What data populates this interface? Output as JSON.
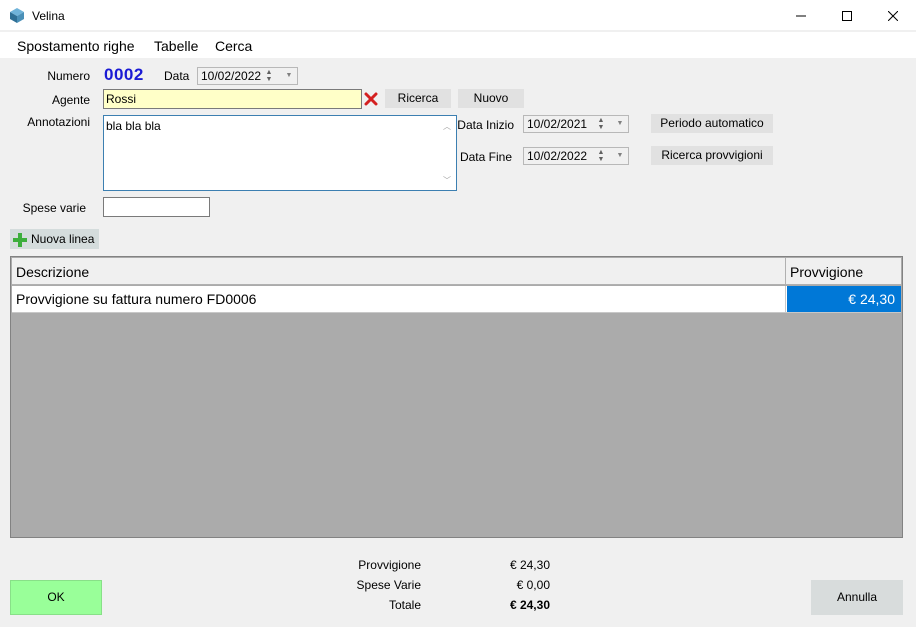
{
  "window": {
    "title": "Velina",
    "minimize": "—",
    "maximize": "☐",
    "close": "✕"
  },
  "menu": {
    "items": [
      "Spostamento righe",
      "Tabelle",
      "Cerca"
    ]
  },
  "form": {
    "numero_label": "Numero",
    "numero_value": "0002",
    "data_label": "Data",
    "data_value": "10/02/2022",
    "agente_label": "Agente",
    "agente_value": "Rossi",
    "ricerca_label": "Ricerca",
    "nuovo_label": "Nuovo",
    "annotazioni_label": "Annotazioni",
    "annotazioni_value": "bla bla bla",
    "data_inizio_label": "Data Inizio",
    "data_inizio_value": "10/02/2021",
    "data_fine_label": "Data Fine",
    "data_fine_value": "10/02/2022",
    "periodo_automatico_label": "Periodo automatico",
    "ricerca_provvigioni_label": "Ricerca provvigioni",
    "spese_varie_label": "Spese varie",
    "spese_varie_value": "",
    "nuova_linea_label": "Nuova linea"
  },
  "grid": {
    "columns": [
      "Descrizione",
      "Provvigione"
    ],
    "rows": [
      {
        "descrizione": "Provvigione su fattura numero FD0006",
        "provvigione": "€ 24,30"
      }
    ]
  },
  "totals": {
    "provvigione_label": "Provvigione",
    "provvigione_value": "€ 24,30",
    "spese_varie_label": "Spese Varie",
    "spese_varie_value": "€ 0,00",
    "totale_label": "Totale",
    "totale_value": "€ 24,30"
  },
  "footer": {
    "ok_label": "OK",
    "annulla_label": "Annulla"
  },
  "colors": {
    "accent_blue": "#0078d7",
    "numero_blue": "#1a1ad4",
    "ok_green": "#99ff99",
    "agente_yellow": "#ffffc8",
    "delete_red": "#d42020"
  },
  "icons": {
    "app": "cube-icon",
    "delete": "red-x-icon",
    "add": "green-plus-icon"
  }
}
